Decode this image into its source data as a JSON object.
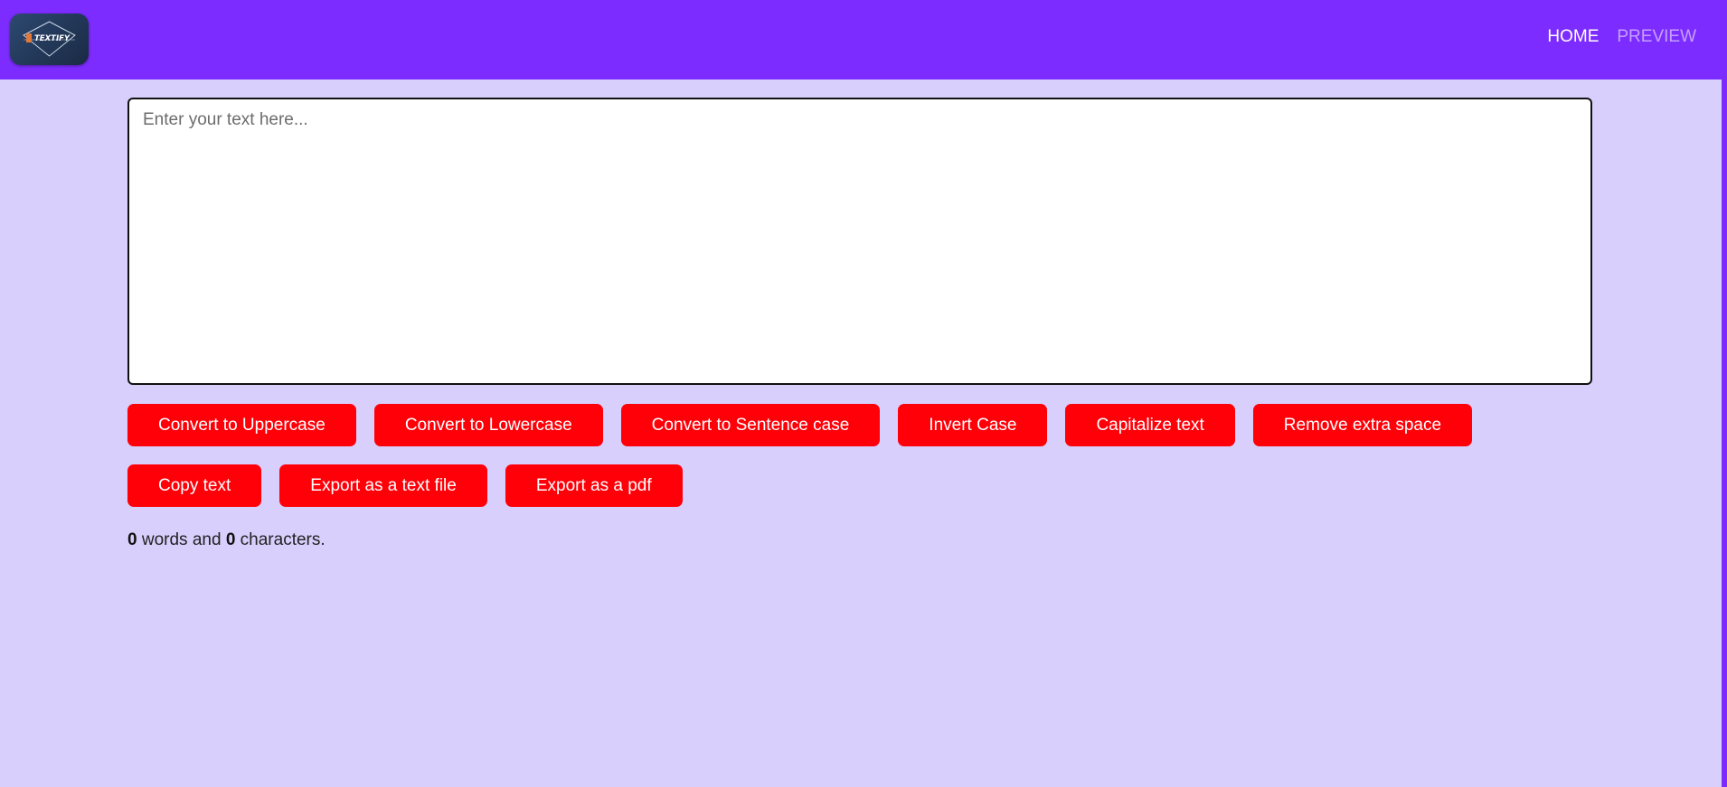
{
  "navbar": {
    "logo_text": "TEXTIFY",
    "links": [
      {
        "label": "HOME",
        "active": true
      },
      {
        "label": "PREVIEW",
        "active": false
      }
    ]
  },
  "editor": {
    "placeholder": "Enter your text here...",
    "value": ""
  },
  "buttons": {
    "row1": [
      "Convert to Uppercase",
      "Convert to Lowercase",
      "Convert to Sentence case",
      "Invert Case",
      "Capitalize text",
      "Remove extra space"
    ],
    "row2": [
      "Copy text",
      "Export as a text file",
      "Export as a pdf"
    ]
  },
  "summary": {
    "word_count": "0",
    "words_label": " words and ",
    "char_count": "0",
    "chars_label": " characters."
  },
  "colors": {
    "navbar": "#7d2cff",
    "background": "#d8cffd",
    "button": "#ff0008",
    "button_text": "#ffffff"
  }
}
